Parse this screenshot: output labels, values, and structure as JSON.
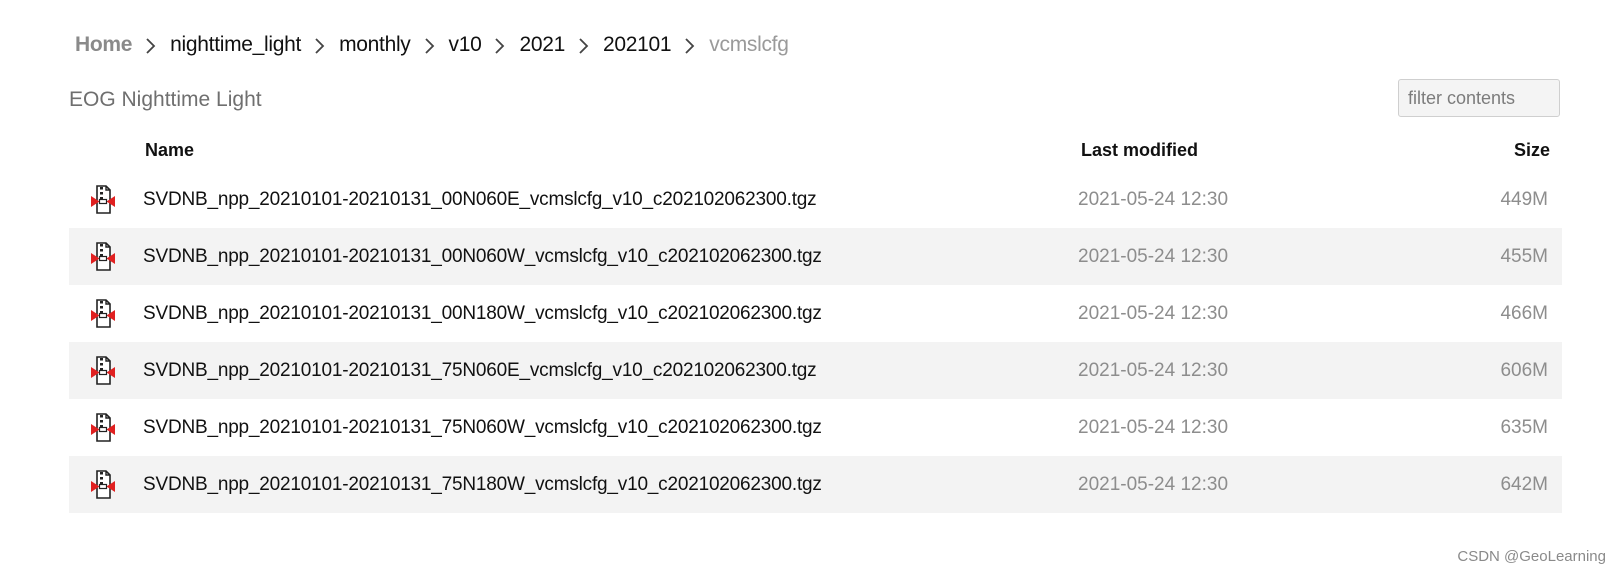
{
  "breadcrumb": {
    "items": [
      "Home",
      "nighttime_light",
      "monthly",
      "v10",
      "2021",
      "202101",
      "vcmslcfg"
    ]
  },
  "site_title": "EOG Nighttime Light",
  "filter": {
    "placeholder": "filter contents",
    "value": ""
  },
  "table": {
    "headers": {
      "name": "Name",
      "modified": "Last modified",
      "size": "Size"
    },
    "rows": [
      {
        "name": "SVDNB_npp_20210101-20210131_00N060E_vcmslcfg_v10_c202102062300.tgz",
        "modified": "2021-05-24 12:30",
        "size": "449M",
        "icon": "archive-file-icon"
      },
      {
        "name": "SVDNB_npp_20210101-20210131_00N060W_vcmslcfg_v10_c202102062300.tgz",
        "modified": "2021-05-24 12:30",
        "size": "455M",
        "icon": "archive-file-icon"
      },
      {
        "name": "SVDNB_npp_20210101-20210131_00N180W_vcmslcfg_v10_c202102062300.tgz",
        "modified": "2021-05-24 12:30",
        "size": "466M",
        "icon": "archive-file-icon"
      },
      {
        "name": "SVDNB_npp_20210101-20210131_75N060E_vcmslcfg_v10_c202102062300.tgz",
        "modified": "2021-05-24 12:30",
        "size": "606M",
        "icon": "archive-file-icon"
      },
      {
        "name": "SVDNB_npp_20210101-20210131_75N060W_vcmslcfg_v10_c202102062300.tgz",
        "modified": "2021-05-24 12:30",
        "size": "635M",
        "icon": "archive-file-icon"
      },
      {
        "name": "SVDNB_npp_20210101-20210131_75N180W_vcmslcfg_v10_c202102062300.tgz",
        "modified": "2021-05-24 12:30",
        "size": "642M",
        "icon": "archive-file-icon"
      }
    ]
  },
  "watermark": "CSDN @GeoLearning",
  "colors": {
    "icon_red": "#e02020",
    "row_alt": "#f3f3f3",
    "muted_text": "#8d8d8d"
  }
}
